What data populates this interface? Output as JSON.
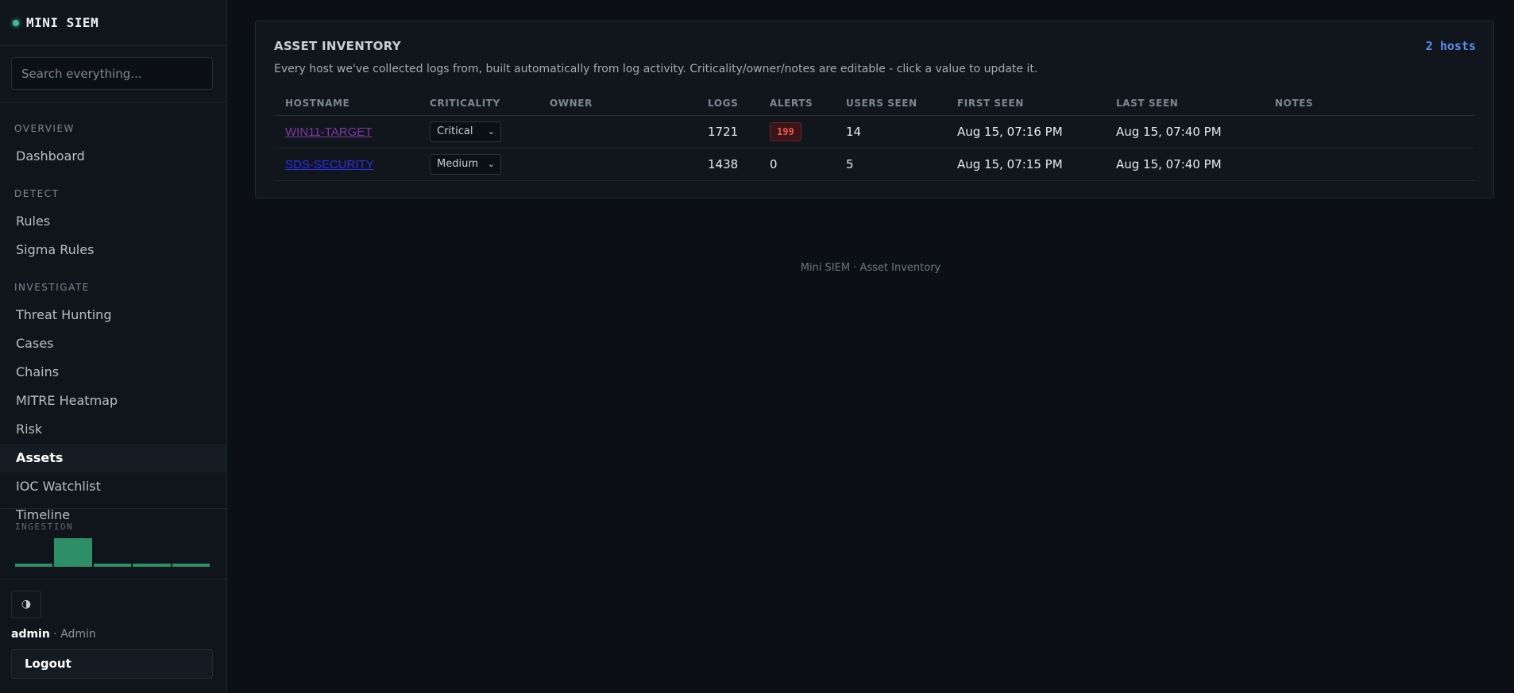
{
  "brand": {
    "name": "MINI SIEM",
    "status_color": "#3fbf86"
  },
  "search": {
    "placeholder": "Search everything..."
  },
  "nav": {
    "sections": [
      {
        "label": "OVERVIEW",
        "items": [
          "Dashboard"
        ]
      },
      {
        "label": "DETECT",
        "items": [
          "Rules",
          "Sigma Rules"
        ]
      },
      {
        "label": "INVESTIGATE",
        "items": [
          "Threat Hunting",
          "Cases",
          "Chains",
          "MITRE Heatmap",
          "Risk",
          "Assets",
          "IOC Watchlist",
          "Timeline"
        ]
      }
    ],
    "active": "Assets"
  },
  "ingestion": {
    "label": "INGESTION",
    "bars": [
      0.1,
      1.0,
      0.1,
      0.1,
      0.1
    ],
    "color": "#2e8f66"
  },
  "theme_toggle": {
    "glyph": "◑",
    "icon": "contrast-icon"
  },
  "user": {
    "name": "admin",
    "role": "Admin",
    "logout_label": "Logout"
  },
  "card": {
    "title": "ASSET INVENTORY",
    "count": "2 hosts",
    "description": "Every host we've collected logs from, built automatically from log activity. Criticality/owner/notes are editable - click a value to update it.",
    "columns": [
      "HOSTNAME",
      "CRITICALITY",
      "OWNER",
      "LOGS",
      "ALERTS",
      "USERS SEEN",
      "FIRST SEEN",
      "LAST SEEN",
      "NOTES"
    ],
    "rows": [
      {
        "hostname": "WIN11-TARGET",
        "criticality": "Critical",
        "owner": "",
        "logs": "1721",
        "alerts": "199",
        "users_seen": "14",
        "first_seen": "Aug 15, 07:16 PM",
        "last_seen": "Aug 15, 07:40 PM",
        "notes": ""
      },
      {
        "hostname": "SDS-SECURITY",
        "criticality": "Medium",
        "owner": "",
        "logs": "1438",
        "alerts": "0",
        "users_seen": "5",
        "first_seen": "Aug 15, 07:15 PM",
        "last_seen": "Aug 15, 07:40 PM",
        "notes": ""
      }
    ]
  },
  "footer": {
    "text": "Mini SIEM · Asset Inventory"
  },
  "colors": {
    "accent": "#5b8def",
    "alert_red": "#f0564f",
    "background": "#0c1016"
  }
}
